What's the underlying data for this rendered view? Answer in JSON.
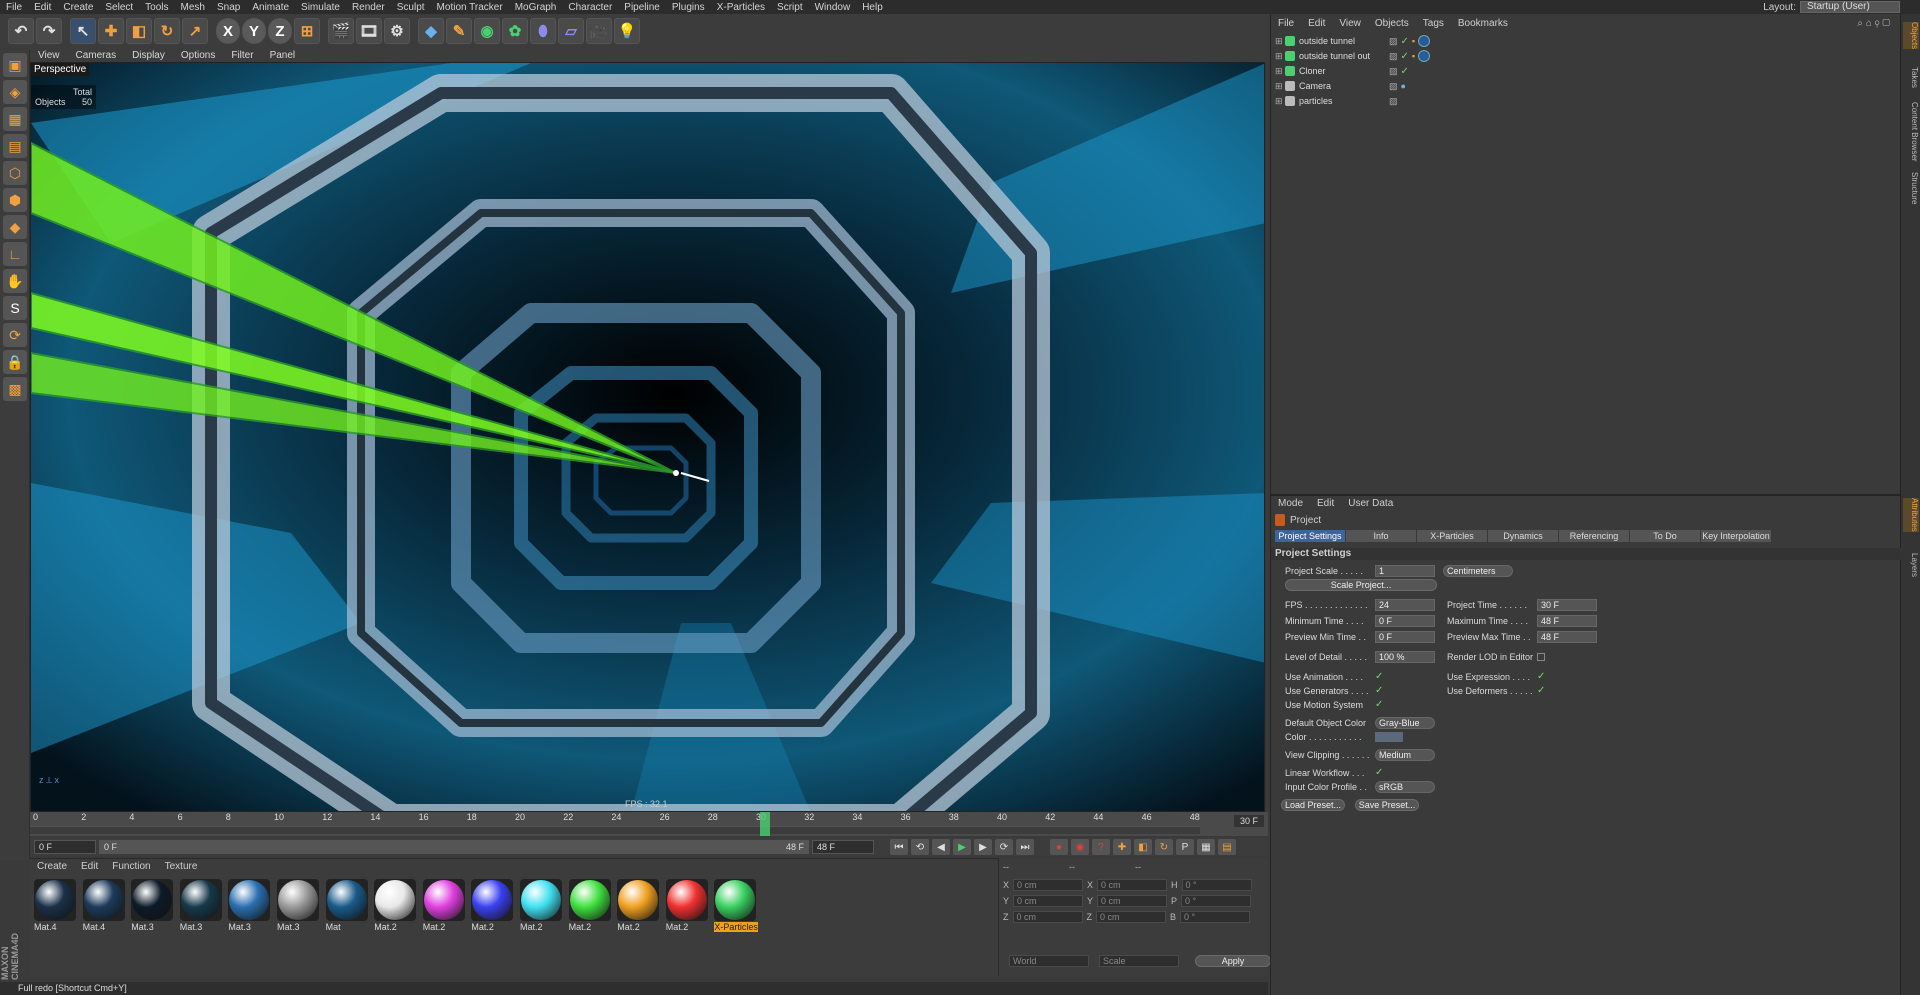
{
  "menubar": [
    "File",
    "Edit",
    "Create",
    "Select",
    "Tools",
    "Mesh",
    "Snap",
    "Animate",
    "Simulate",
    "Render",
    "Sculpt",
    "Motion Tracker",
    "MoGraph",
    "Character",
    "Pipeline",
    "Plugins",
    "X-Particles",
    "Script",
    "Window",
    "Help"
  ],
  "layout": {
    "label": "Layout:",
    "value": "Startup (User)"
  },
  "viewport": {
    "menu": [
      "View",
      "Cameras",
      "Display",
      "Options",
      "Filter",
      "Panel"
    ],
    "camera_label": "Perspective",
    "stats_total": "Total",
    "stats_objects_label": "Objects",
    "stats_objects_value": "50",
    "fps": "FPS : 32.1"
  },
  "timeline": {
    "ticks": [
      "0",
      "2",
      "4",
      "6",
      "8",
      "10",
      "12",
      "14",
      "16",
      "18",
      "20",
      "22",
      "24",
      "26",
      "28",
      "30",
      "32",
      "34",
      "36",
      "38",
      "40",
      "42",
      "44",
      "46",
      "48"
    ],
    "current_frame": "30",
    "end_label": "30 F"
  },
  "transport": {
    "start_field": "0 F",
    "range_start": "0 F",
    "range_end": "48 F",
    "end_field": "48 F"
  },
  "materials": {
    "menu": [
      "Create",
      "Edit",
      "Function",
      "Texture"
    ],
    "items": [
      {
        "name": "Mat.4",
        "color": "#1a3048"
      },
      {
        "name": "Mat.4",
        "color": "#1c3a5a"
      },
      {
        "name": "Mat.3",
        "color": "#0d1a28"
      },
      {
        "name": "Mat.3",
        "color": "#17384a"
      },
      {
        "name": "Mat.3",
        "color": "#2a6fb0"
      },
      {
        "name": "Mat.3",
        "color": "#9a9a9a"
      },
      {
        "name": "Mat",
        "color": "#1a5a8a"
      },
      {
        "name": "Mat.2",
        "color": "#e8e8e8"
      },
      {
        "name": "Mat.2",
        "color": "#e040e0"
      },
      {
        "name": "Mat.2",
        "color": "#3a40f0"
      },
      {
        "name": "Mat.2",
        "color": "#40e0f0"
      },
      {
        "name": "Mat.2",
        "color": "#40e040"
      },
      {
        "name": "Mat.2",
        "color": "#f0a020"
      },
      {
        "name": "Mat.2",
        "color": "#f03030"
      },
      {
        "name": "X-Particles",
        "color": "#3ad060"
      }
    ]
  },
  "coords": {
    "header": [
      "--",
      "--",
      "--"
    ],
    "rows": [
      {
        "a": "X",
        "av": "0 cm",
        "b": "X",
        "bv": "0 cm",
        "c": "H",
        "cv": "0 °"
      },
      {
        "a": "Y",
        "av": "0 cm",
        "b": "Y",
        "bv": "0 cm",
        "c": "P",
        "cv": "0 °"
      },
      {
        "a": "Z",
        "av": "0 cm",
        "b": "Z",
        "bv": "0 cm",
        "c": "B",
        "cv": "0 °"
      }
    ],
    "world": "World",
    "scale": "Scale",
    "apply": "Apply"
  },
  "status": "Full redo [Shortcut Cmd+Y]",
  "brand": "MAXON CINEMA4D",
  "objects": {
    "menu": [
      "File",
      "Edit",
      "View",
      "Objects",
      "Tags",
      "Bookmarks"
    ],
    "rows": [
      {
        "name": "outside tunnel",
        "icon_color": "#4ad070"
      },
      {
        "name": "outside tunnel out",
        "icon_color": "#4ad070"
      },
      {
        "name": "Cloner",
        "icon_color": "#4ad070"
      },
      {
        "name": "Camera",
        "icon_color": "#bbbbbb"
      },
      {
        "name": "particles",
        "icon_color": "#bbbbbb"
      }
    ]
  },
  "right_tabs_top": [
    "Objects",
    "Takes",
    "Content Browser",
    "Structure"
  ],
  "right_tabs_bottom": [
    "Attributes",
    "Layers"
  ],
  "attributes": {
    "menu": [
      "Mode",
      "Edit",
      "User Data"
    ],
    "title": "Project",
    "tabs": [
      "Project Settings",
      "Info",
      "X-Particles",
      "Dynamics",
      "Referencing",
      "To Do",
      "Key Interpolation"
    ],
    "section": "Project Settings",
    "project_scale": {
      "label": "Project Scale . . . . .",
      "value": "1",
      "unit": "Centimeters"
    },
    "scale_project_btn": "Scale Project...",
    "fps": {
      "label": "FPS . . . . . . . . . . . . .",
      "value": "24"
    },
    "project_time": {
      "label": "Project Time . . . . . .",
      "value": "30 F"
    },
    "min_time": {
      "label": "Minimum Time . . . .",
      "value": "0 F"
    },
    "max_time": {
      "label": "Maximum Time . . . .",
      "value": "48 F"
    },
    "preview_min": {
      "label": "Preview Min Time . .",
      "value": "0 F"
    },
    "preview_max": {
      "label": "Preview Max Time . .",
      "value": "48 F"
    },
    "lod": {
      "label": "Level of Detail . . . . .",
      "value": "100 %"
    },
    "render_lod": "Render LOD in Editor",
    "use_animation": "Use Animation . . . .",
    "use_expression": "Use Expression . . . .",
    "use_generators": "Use Generators . . . .",
    "use_deformers": "Use Deformers . . . . .",
    "use_motion": "Use Motion System",
    "default_color": {
      "label": "Default Object Color",
      "value": "Gray-Blue"
    },
    "color_label": "Color . . . . . . . . . . .",
    "view_clipping": {
      "label": "View Clipping . . . . . .",
      "value": "Medium"
    },
    "linear_workflow": "Linear Workflow . . .",
    "input_profile": {
      "label": "Input Color Profile . .",
      "value": "sRGB"
    },
    "load_preset": "Load Preset...",
    "save_preset": "Save Preset..."
  }
}
